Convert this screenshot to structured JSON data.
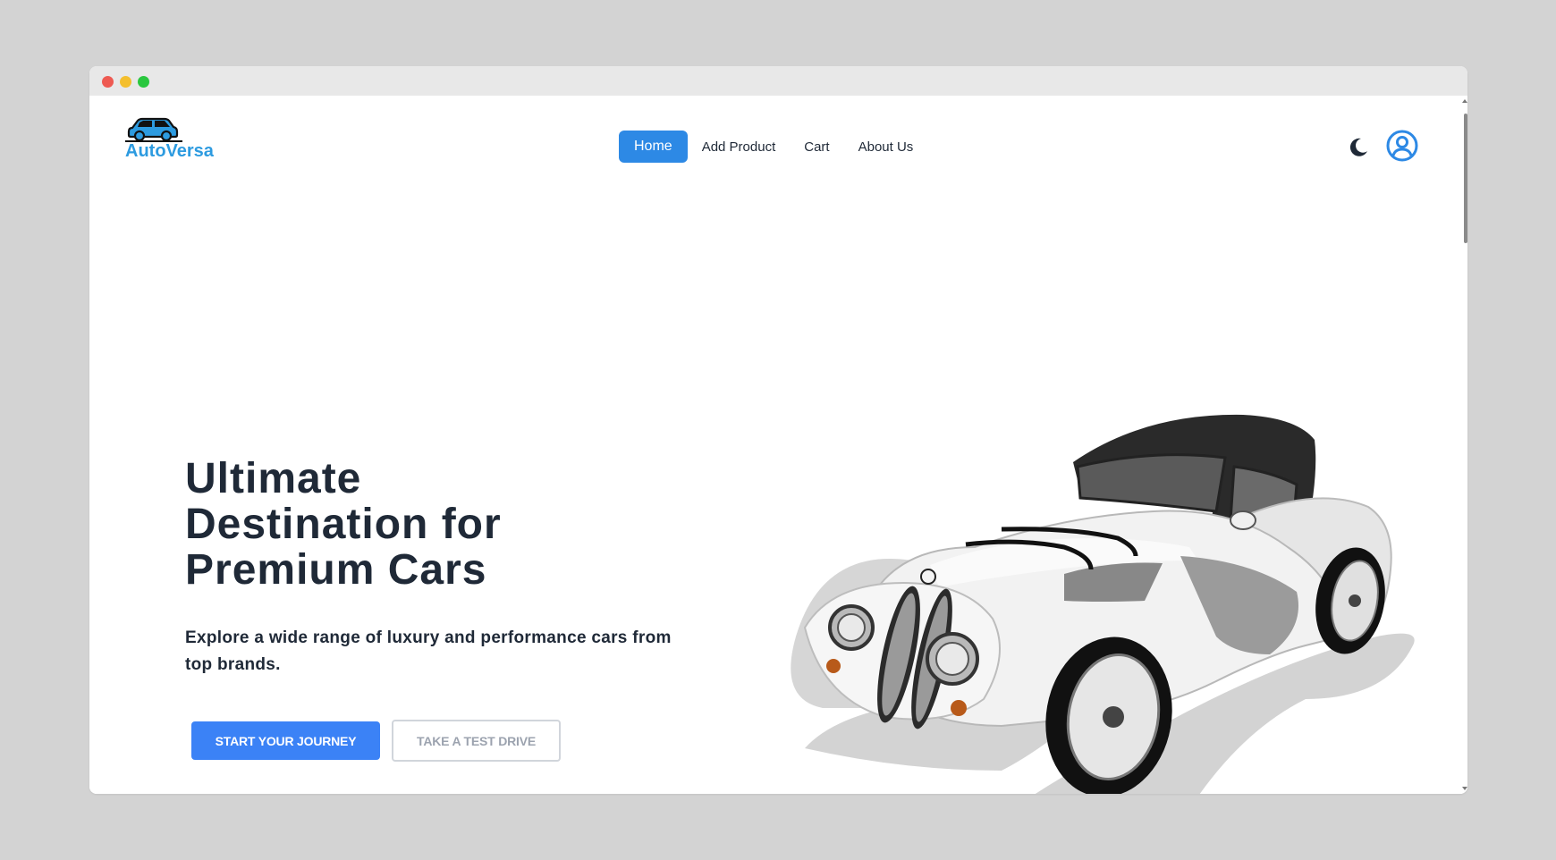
{
  "brand": {
    "name": "AutoVersa",
    "color": "#2d9be0",
    "icon": "car-logo-icon"
  },
  "nav": {
    "items": [
      {
        "label": "Home",
        "active": true
      },
      {
        "label": "Add Product",
        "active": false
      },
      {
        "label": "Cart",
        "active": false
      },
      {
        "label": "About Us",
        "active": false
      }
    ],
    "active_color": "#2d89e5"
  },
  "header_icons": {
    "theme_toggle": "moon-icon",
    "profile": "user-circle-icon"
  },
  "hero": {
    "title": "Ultimate Destination for Premium Cars",
    "subtitle": "Explore a wide range of luxury and performance cars from top brands.",
    "primary_button": "START YOUR JOURNEY",
    "secondary_button": "TAKE A TEST DRIVE",
    "image": "vintage-roadster-car-illustration"
  },
  "colors": {
    "primary": "#3b82f6",
    "text": "#1f2937",
    "muted": "#9ca3af"
  }
}
